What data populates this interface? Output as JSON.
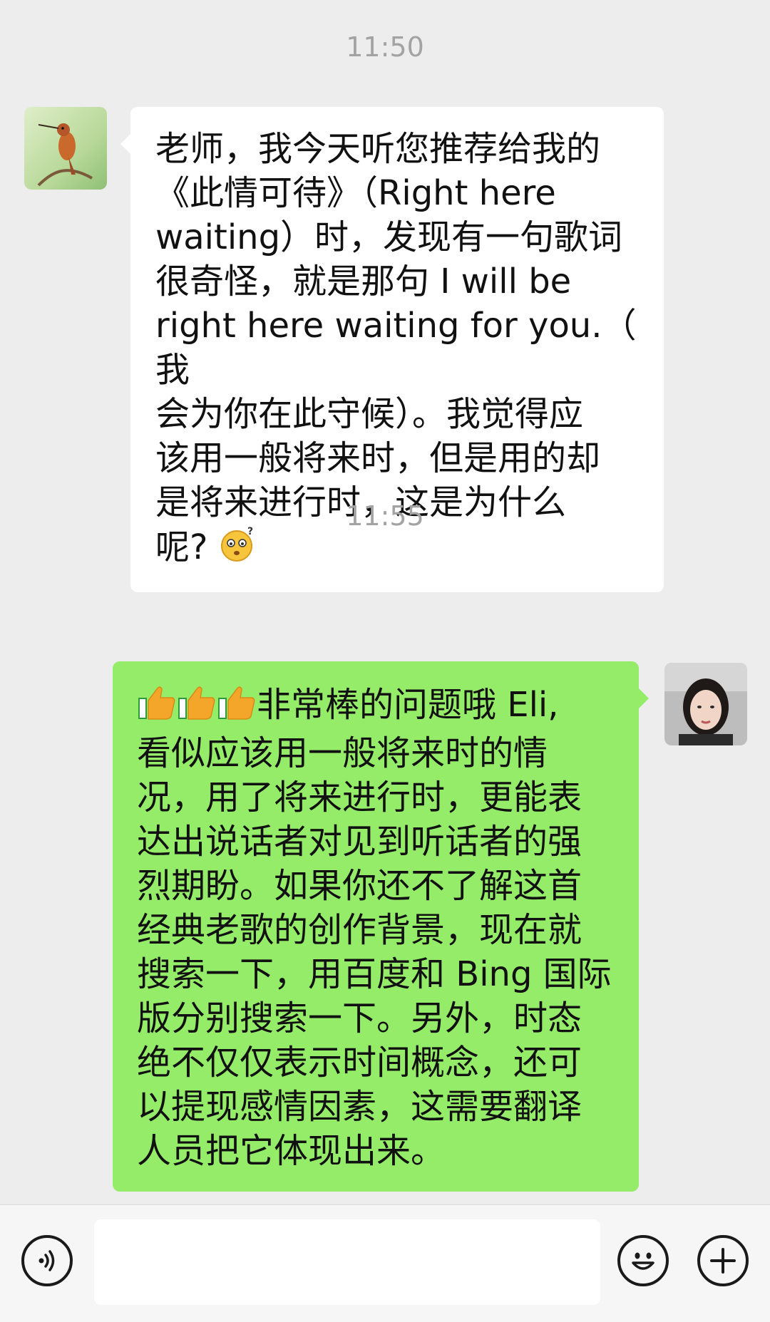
{
  "chat": {
    "timestamps": [
      "11:50",
      "11:55"
    ],
    "messages": [
      {
        "sender": "incoming",
        "lines": [
          "老师，我今天听您推荐给我的",
          "《此情可待》（Right here",
          "waiting）时，发现有一句歌词",
          "很奇怪，就是那句 I will be",
          "right here waiting for you.（ 我",
          "会为你在此守候）。我觉得应",
          "该用一般将来时，但是用的却",
          "是将来进行时，这是为什么",
          "呢?"
        ],
        "emoji": "thinking-confused-emoji"
      },
      {
        "sender": "outgoing",
        "emojis": [
          "thumbs-up-emoji",
          "thumbs-up-emoji",
          "thumbs-up-emoji"
        ],
        "lines": [
          "非常棒的问题哦 Eli,",
          "看似应该用一般将来时的情",
          "况，用了将来进行时，更能表",
          "达出说话者对见到听话者的强",
          "烈期盼。如果你还不了解这首",
          "经典老歌的创作背景，现在就",
          "搜索一下，用百度和 Bing 国际",
          "版分别搜索一下。另外，时态",
          "绝不仅仅表示时间概念，还可",
          "以提现感情因素，这需要翻译",
          "人员把它体现出来。"
        ]
      }
    ]
  },
  "input_bar": {
    "text_value": "",
    "icons": [
      "voice-icon",
      "emoji-icon",
      "plus-icon"
    ]
  },
  "colors": {
    "background": "#ededed",
    "incoming_bubble": "#ffffff",
    "outgoing_bubble": "#95ec69",
    "timestamp": "#a3a3a3"
  }
}
